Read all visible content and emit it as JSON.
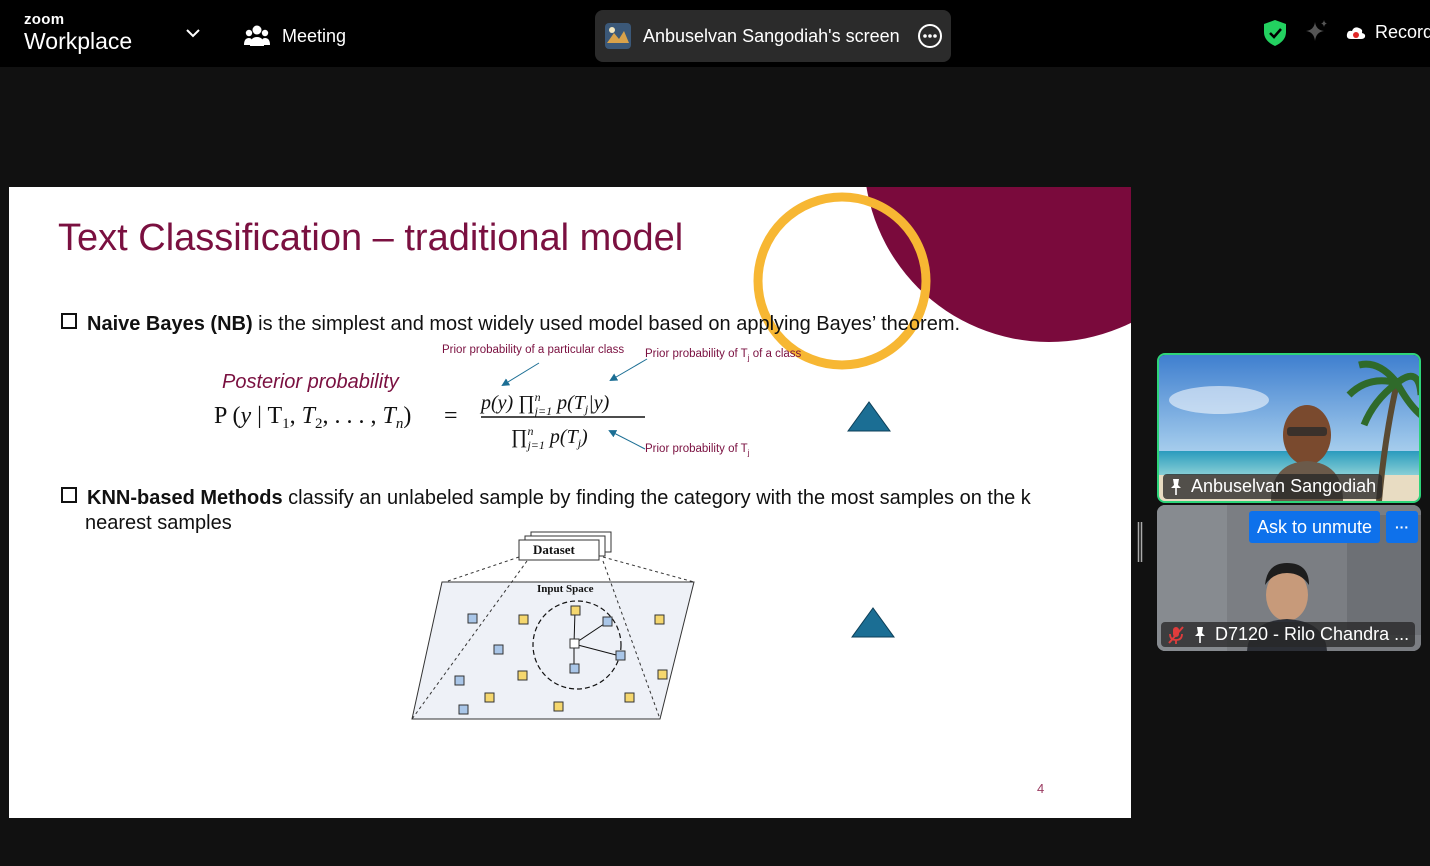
{
  "app": {
    "brand_small": "zoom",
    "brand_big": "Workplace"
  },
  "header": {
    "meeting_label": "Meeting",
    "share_label": "Anbuselvan Sangodiah's screen",
    "record_label": "Record"
  },
  "slide": {
    "title": "Text Classification – traditional model",
    "bullet1_bold": "Naive Bayes (NB)",
    "bullet1_rest": " is the simplest and most widely used model based on applying Bayes’ theorem.",
    "ann_prior_class": "Prior probability of a particular class",
    "ann_prior_tj_class": "Prior probability of T",
    "ann_prior_tj_class_suffix": "of a class",
    "ann_prior_tj": "Prior probability of T",
    "sub_j": "j",
    "posterior": "Posterior probability",
    "bullet2_bold": "KNN-based Methods",
    "bullet2_rest": " classify an unlabeled sample by finding the category with the most samples on the k",
    "bullet2_cont": "nearest samples",
    "diagram_dataset": "Dataset",
    "diagram_input": "Input Space",
    "page_number": "4"
  },
  "participants": [
    {
      "name": "Anbuselvan Sangodiah"
    },
    {
      "name": "D7120 - Rilo Chandra ...",
      "ask_label": "Ask to unmute",
      "more_label": "···"
    }
  ],
  "colors": {
    "accent": "#7a1040",
    "ring": "#f7b733",
    "triangle": "#1b6e94",
    "speaking": "#2ed47a",
    "button": "#0e71eb"
  }
}
